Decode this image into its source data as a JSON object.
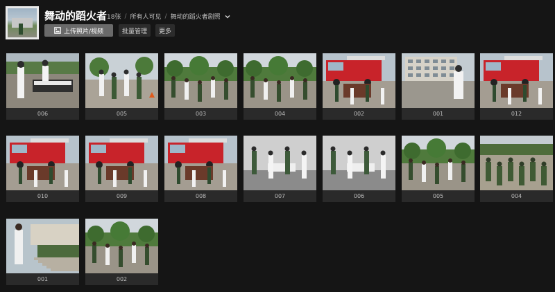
{
  "album": {
    "title": "舞动的蹈火者",
    "count": "18张",
    "visibility": "所有人可见",
    "album_name": "舞动的蹈火者剧照",
    "upload_label": "上传照片/视频",
    "batch_label": "批量管理",
    "more_label": "更多"
  },
  "photos": [
    {
      "caption": "006",
      "scene": "keyboard"
    },
    {
      "caption": "005",
      "scene": "plaza"
    },
    {
      "caption": "003",
      "scene": "trees"
    },
    {
      "caption": "004",
      "scene": "trees"
    },
    {
      "caption": "002",
      "scene": "truck"
    },
    {
      "caption": "001",
      "scene": "building"
    },
    {
      "caption": "012",
      "scene": "truck"
    },
    {
      "caption": "010",
      "scene": "truck"
    },
    {
      "caption": "009",
      "scene": "truck"
    },
    {
      "caption": "008",
      "scene": "truck"
    },
    {
      "caption": "007",
      "scene": "indoor"
    },
    {
      "caption": "006",
      "scene": "indoor"
    },
    {
      "caption": "005",
      "scene": "trees"
    },
    {
      "caption": "004",
      "scene": "soldiers"
    },
    {
      "caption": "001",
      "scene": "steps"
    },
    {
      "caption": "002",
      "scene": "trees"
    }
  ]
}
